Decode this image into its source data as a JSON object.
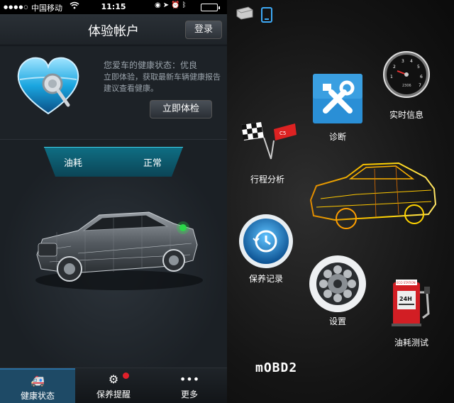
{
  "status_bar": {
    "signal": "●●●●○",
    "carrier": "中国移动",
    "time": "11:15",
    "battery_level": 0.9,
    "icons": [
      "location-icon",
      "alarm-icon",
      "bluetooth-icon",
      "battery-icon"
    ]
  },
  "nav": {
    "title": "体验帐户",
    "login_label": "登录"
  },
  "health": {
    "status_line": "您爱车的健康状态：优良",
    "description": "立即体验，获取最新车辆健康报告建议查看健康。",
    "check_button": "立即体检"
  },
  "fuel_banner": {
    "label": "油耗",
    "status": "正常"
  },
  "tabs": [
    {
      "label": "健康状态",
      "icon": "car-icon",
      "active": true
    },
    {
      "label": "保养提醒",
      "icon": "maintenance-icon",
      "badge": true
    },
    {
      "label": "更多",
      "icon": "more-icon"
    }
  ],
  "menu": {
    "realtime": "实时信息",
    "diagnosis": "诊断",
    "trip": "行程分析",
    "maintenance_record": "保养记录",
    "settings": "设置",
    "fuel_test": "油耗测试",
    "logo": "mOBD2",
    "gauge_numbers": [
      "3",
      "4",
      "2",
      "5",
      "1",
      "6",
      "7",
      "2306"
    ],
    "fuel_station_labels": {
      "sign": "ECO STATION",
      "display": "24H"
    }
  },
  "colors": {
    "accent_blue": "#2a9fd6",
    "tab_active": "#1e4a66",
    "badge_red": "#e0202a"
  }
}
